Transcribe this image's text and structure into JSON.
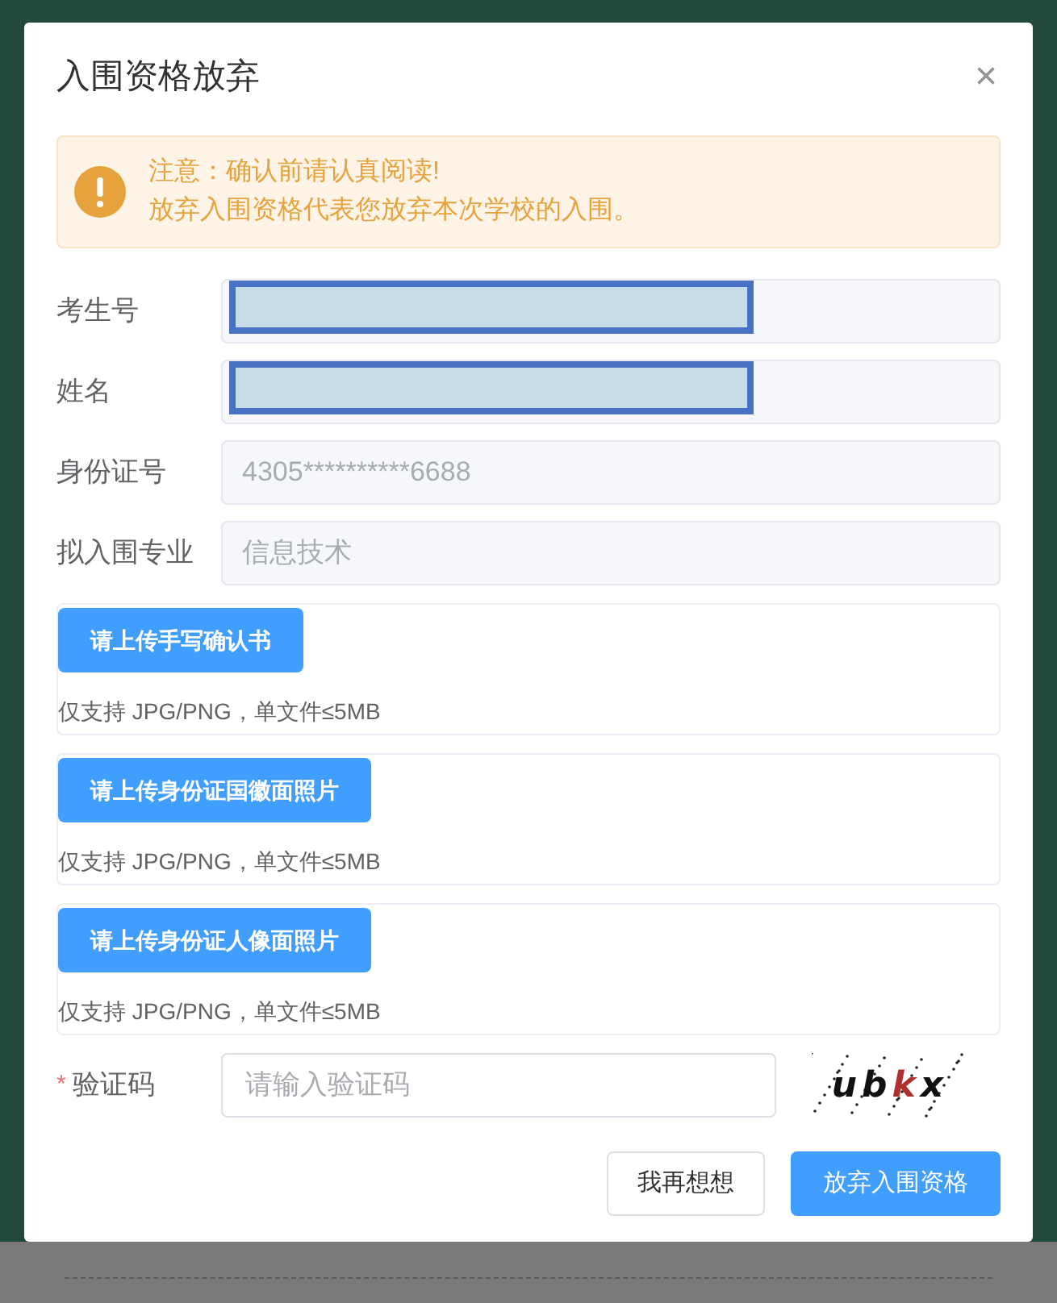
{
  "dialog": {
    "title": "入围资格放弃",
    "close": "×"
  },
  "alert": {
    "title": "注意：确认前请认真阅读!",
    "text": "放弃入围资格代表您放弃本次学校的入围。"
  },
  "fields": [
    {
      "label": "考生号",
      "redacted": true,
      "disabled": true
    },
    {
      "label": "姓名",
      "redacted": true,
      "disabled": true
    },
    {
      "label": "身份证号",
      "value": "4305**********6688",
      "redacted": false,
      "disabled": true
    },
    {
      "label": "拟入围专业",
      "value": "信息技术",
      "redacted": false,
      "disabled": true
    }
  ],
  "uploads": [
    {
      "button": "请上传手写确认书",
      "hint": "仅支持 JPG/PNG，单文件≤5MB"
    },
    {
      "button": "请上传身份证国徽面照片",
      "hint": "仅支持 JPG/PNG，单文件≤5MB"
    },
    {
      "button": "请上传身份证人像面照片",
      "hint": "仅支持 JPG/PNG，单文件≤5MB"
    }
  ],
  "captcha": {
    "required_mark": "*",
    "label": "验证码",
    "placeholder": "请输入验证码",
    "code": [
      {
        "char": "u",
        "color": "#111111"
      },
      {
        "char": "b",
        "color": "#111111"
      },
      {
        "char": "k",
        "color": "#b03030"
      },
      {
        "char": "x",
        "color": "#111111"
      }
    ]
  },
  "buttons": [
    {
      "label": "我再想想",
      "kind": "secondary"
    },
    {
      "label": "放弃入围资格",
      "kind": "primary"
    }
  ]
}
